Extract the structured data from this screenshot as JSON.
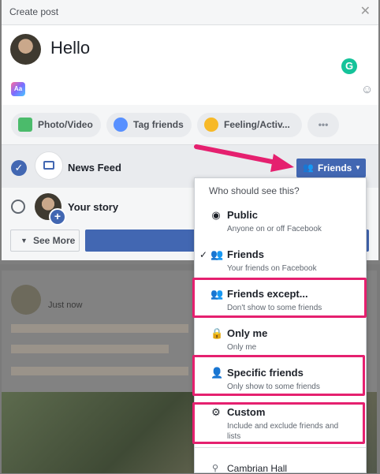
{
  "dialog": {
    "title": "Create post",
    "close": "✕"
  },
  "composer": {
    "text": "Hello",
    "grammarly": "G",
    "bg_icon": "Aa",
    "emoji": "☺"
  },
  "actions": [
    {
      "label": "Photo/Video",
      "icon": "photo-icon",
      "color": "#4bbb6b"
    },
    {
      "label": "Tag friends",
      "icon": "tag-friends-icon",
      "color": "#5890ff"
    },
    {
      "label": "Feeling/Activ...",
      "icon": "feeling-icon",
      "color": "#f7b928"
    },
    {
      "label": "•••",
      "icon": "more-icon"
    }
  ],
  "audience": {
    "news_feed": "News Feed",
    "your_story": "Your story",
    "see_more": "See More",
    "privacy_button": "Friends"
  },
  "menu": {
    "heading": "Who should see this?",
    "items": [
      {
        "title": "Public",
        "subtitle": "Anyone on or off Facebook",
        "icon": "globe-icon",
        "checked": false,
        "highlighted": false
      },
      {
        "title": "Friends",
        "subtitle": "Your friends on Facebook",
        "icon": "friends-icon",
        "checked": true,
        "highlighted": false
      },
      {
        "title": "Friends except...",
        "subtitle": "Don't show to some friends",
        "icon": "friends-except-icon",
        "checked": false,
        "highlighted": true
      },
      {
        "title": "Only me",
        "subtitle": "Only me",
        "icon": "lock-icon",
        "checked": false,
        "highlighted": false
      },
      {
        "title": "Specific friends",
        "subtitle": "Only show to some friends",
        "icon": "person-icon",
        "checked": false,
        "highlighted": true
      },
      {
        "title": "Custom",
        "subtitle": "Include and exclude friends and",
        "subtitle2": "lists",
        "icon": "gear-icon",
        "checked": false,
        "highlighted": true
      }
    ],
    "last_item": "Cambrian Hall"
  },
  "background_post": {
    "time": "Just now"
  },
  "colors": {
    "accent": "#4267b2",
    "highlight": "#e5206f",
    "arrow": "#e5206f"
  }
}
